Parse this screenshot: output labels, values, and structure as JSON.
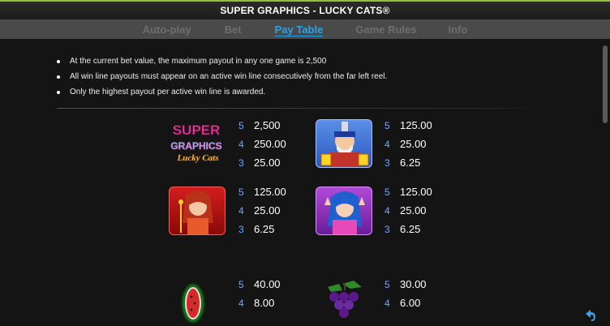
{
  "header": {
    "title": "SUPER GRAPHICS - LUCKY CATS®"
  },
  "tabs": [
    {
      "label": "Auto-play",
      "active": false
    },
    {
      "label": "Bet",
      "active": false
    },
    {
      "label": "Pay Table",
      "active": true
    },
    {
      "label": "Game Rules",
      "active": false
    },
    {
      "label": "Info",
      "active": false
    }
  ],
  "rules": [
    "At the current bet value, the maximum payout in any one game is 2,500",
    "All win line payouts must appear on an active win line consecutively from the far left reel.",
    "Only the highest payout per active win line is awarded."
  ],
  "paytable": [
    {
      "symbol": "logo-super-graphics-lucky-cats",
      "logo_text": [
        "SUPER",
        "GRAPHICS",
        "Lucky Cats"
      ],
      "pays": [
        {
          "count": "5",
          "amount": "2,500"
        },
        {
          "count": "4",
          "amount": "250.00"
        },
        {
          "count": "3",
          "amount": "25.00"
        }
      ]
    },
    {
      "symbol": "samurai-cat-man",
      "pays": [
        {
          "count": "5",
          "amount": "125.00"
        },
        {
          "count": "4",
          "amount": "25.00"
        },
        {
          "count": "3",
          "amount": "6.25"
        }
      ]
    },
    {
      "symbol": "red-haired-woman",
      "pays": [
        {
          "count": "5",
          "amount": "125.00"
        },
        {
          "count": "4",
          "amount": "25.00"
        },
        {
          "count": "3",
          "amount": "6.25"
        }
      ]
    },
    {
      "symbol": "blue-haired-woman",
      "pays": [
        {
          "count": "5",
          "amount": "125.00"
        },
        {
          "count": "4",
          "amount": "25.00"
        },
        {
          "count": "3",
          "amount": "6.25"
        }
      ]
    },
    {
      "symbol": "watermelon",
      "pays": [
        {
          "count": "5",
          "amount": "40.00"
        },
        {
          "count": "4",
          "amount": "8.00"
        }
      ]
    },
    {
      "symbol": "grapes",
      "pays": [
        {
          "count": "5",
          "amount": "30.00"
        },
        {
          "count": "4",
          "amount": "6.00"
        }
      ]
    }
  ],
  "colors": {
    "accent": "#27a3e6",
    "count": "#6fa8ff",
    "frame_green": "#8fc23a",
    "tab_bg": "#4a4a4a"
  }
}
